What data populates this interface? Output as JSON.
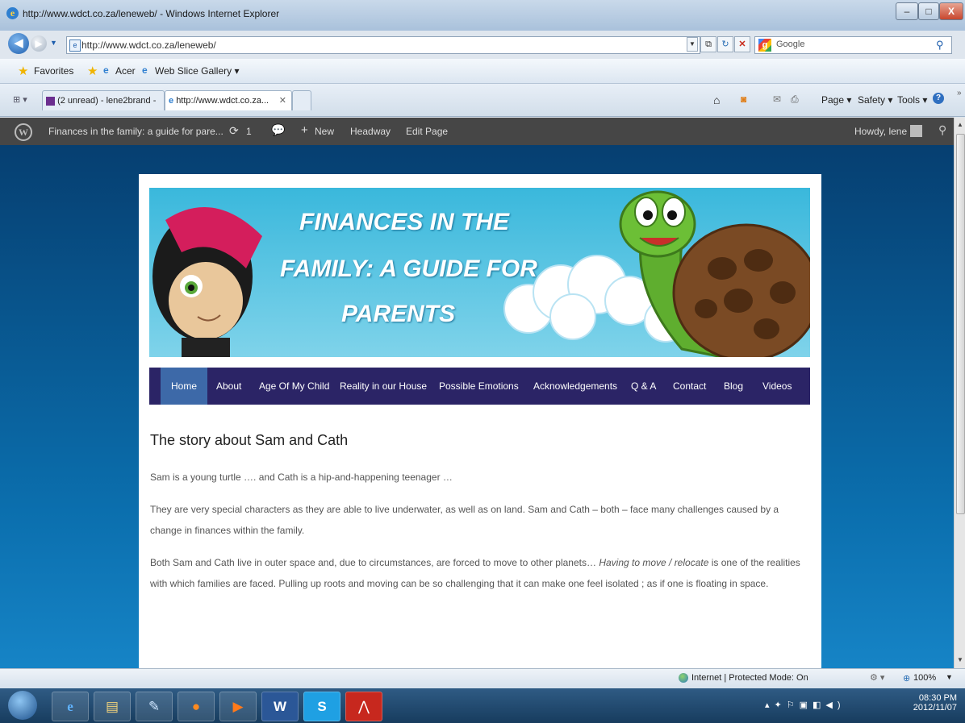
{
  "window": {
    "title": "http://www.wdct.co.za/leneweb/ - Windows Internet Explorer",
    "min": "–",
    "max": "□",
    "close": "X"
  },
  "addressbar": {
    "url": "http://www.wdct.co.za/leneweb/"
  },
  "search": {
    "placeholder": "Google",
    "g": "g"
  },
  "favorites": {
    "label": "Favorites",
    "items": [
      "Acer",
      "Web Slice Gallery ▾"
    ]
  },
  "tabs": [
    {
      "label": "(2 unread) - lene2brand - ..."
    },
    {
      "label": "http://www.wdct.co.za..."
    }
  ],
  "commandbar": {
    "page": "Page ▾",
    "safety": "Safety ▾",
    "tools": "Tools ▾"
  },
  "wpadmin": {
    "site": "Finances in the family: a guide for pare...",
    "updates": "1",
    "new": "New",
    "headway": "Headway",
    "edit": "Edit Page",
    "howdy": "Howdy, lene"
  },
  "banner": {
    "line1": "FINANCES IN THE",
    "line2": "FAMILY: A GUIDE FOR",
    "line3": "PARENTS"
  },
  "nav": [
    "Home",
    "About",
    "Age Of My Child",
    "Reality in our House",
    "Possible Emotions",
    "Acknowledgements",
    "Q & A",
    "Contact",
    "Blog",
    "Videos"
  ],
  "content": {
    "heading": "The story about Sam and Cath",
    "p1": "Sam is a young turtle …. and Cath is a hip-and-happening teenager …",
    "p2": "They are very special characters as they are able to live underwater, as well as on land.  Sam and Cath – both – face many challenges caused by a change in finances within the family.",
    "p3_a": "Both Sam and Cath live in outer space and, due to circumstances, are forced to move to other planets… ",
    "p3_em": "Having to move / relocate",
    "p3_b": " is one of the realities with which families are faced. Pulling up roots and moving can be so challenging that it can make one feel isolated ;  as if one is floating in space."
  },
  "status": {
    "zone": "Internet | Protected Mode: On",
    "zoom": "100%"
  },
  "clock": {
    "time": "08:30 PM",
    "date": "2012/11/07"
  },
  "colors": {
    "wpbar": "#464646",
    "nav": "#2b2466",
    "nav_active": "#3d69a8",
    "page_bg": "#0b6fae"
  }
}
